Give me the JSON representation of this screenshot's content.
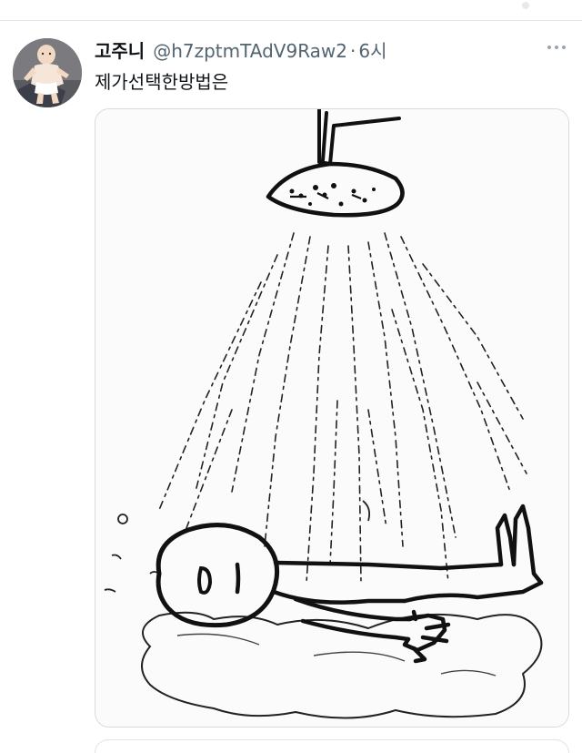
{
  "tweet": {
    "display_name": "고주니",
    "handle": "@h7zptmTAdV9Raw2",
    "separator": "·",
    "time": "6시",
    "text": "제가선택한방법은"
  },
  "icons": {
    "more": "more-horizontal-icon",
    "avatar": "baby-avatar-image"
  },
  "colors": {
    "text": "#0f1419",
    "secondary": "#536471",
    "border": "#d5dbe0"
  },
  "media": {
    "kind": "sketch drawing",
    "subject": "shower-sketch"
  }
}
